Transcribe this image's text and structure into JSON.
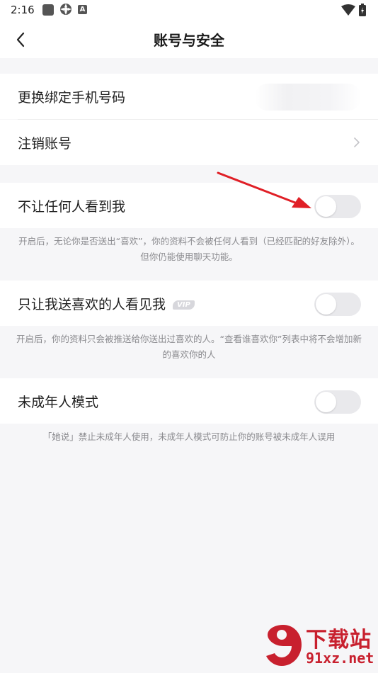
{
  "status_bar": {
    "time": "2:16",
    "notification_letter": "A"
  },
  "header": {
    "title": "账号与安全"
  },
  "rows": {
    "change_phone": {
      "label": "更换绑定手机号码"
    },
    "delete_account": {
      "label": "注销账号"
    },
    "hide_from_everyone": {
      "label": "不让任何人看到我",
      "toggle_on": false,
      "note": "开启后，无论你是否送出“喜欢”，你的资料不会被任何人看到（已经匹配的好友除外）。但你仍能使用聊天功能。"
    },
    "only_liked_see_me": {
      "label": "只让我送喜欢的人看见我",
      "badge": "VIP",
      "toggle_on": false,
      "note": "开启后，你的资料只会被推送给你送出过喜欢的人。“查看谁喜欢你”列表中将不会增加新的喜欢你的人"
    },
    "minor_mode": {
      "label": "未成年人模式",
      "toggle_on": false,
      "note": "「她说」禁止未成年人使用，未成年人模式可防止你的账号被未成年人误用"
    }
  },
  "colors": {
    "annotation_arrow": "#e01f26",
    "toggle_off": "#e9e9ec",
    "watermark": "#c8202e"
  },
  "watermark": {
    "top": "下载站",
    "bottom": "91xz.net"
  }
}
